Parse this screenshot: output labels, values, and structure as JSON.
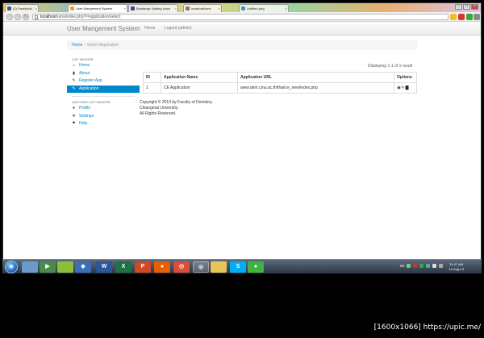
{
  "browser": {
    "tabs": [
      {
        "label": "(2) Facebook",
        "color": "#3b5998"
      },
      {
        "label": "User Mangement System",
        "color": "#e8a33a"
      },
      {
        "label": "Bootstrap: Adding Icons",
        "color": "#563d7c"
      },
      {
        "label": "localhost/ums",
        "color": "#7a7a7a"
      },
      {
        "label": "Untitled-png",
        "color": "#4a90d9"
      }
    ],
    "url_host": "localhost",
    "url_path": "/ums/index.php?r=application/select"
  },
  "site": {
    "brand": "User Mangement System",
    "nav": {
      "home": "Home",
      "logout": "Logout (admin)"
    }
  },
  "breadcrumb": {
    "home": "Home",
    "separator": "/",
    "current": "Select Application"
  },
  "sidebar": {
    "header1": "LIST HEADER",
    "items1": [
      {
        "label": "Home",
        "icon": "home-icon"
      },
      {
        "label": "About",
        "icon": "book-icon"
      },
      {
        "label": "Register App",
        "icon": "pencil-icon"
      },
      {
        "label": "Application",
        "icon": "pencil-icon"
      }
    ],
    "header2": "ANOTHER LIST HEADER",
    "items2": [
      {
        "label": "Profile",
        "icon": "user-icon"
      },
      {
        "label": "Settings",
        "icon": "gear-icon"
      },
      {
        "label": "Help",
        "icon": "flag-icon"
      }
    ]
  },
  "summary": "Displaying 1-1 of 1 result",
  "table": {
    "headers": [
      "ID",
      "Application Name",
      "Application URL",
      "Options"
    ],
    "rows": [
      {
        "id": "1",
        "name": "CE Application",
        "url": "www.dent.cmu.ac.th/thai/ce_new/index.php"
      }
    ]
  },
  "footer": {
    "line1": "Copyright © 2013 by Faculty of Dentistry.",
    "line2": "Chiangmai University.",
    "line3": "All Rights Reserved."
  },
  "taskbar": {
    "lang": "TH",
    "time": "11:47 AM",
    "date": "14-Aug-13",
    "icons": [
      "explorer-icon",
      "media-icon",
      "files-icon",
      "virtualbox-icon",
      "word-icon",
      "excel-icon",
      "powerpoint-icon",
      "firefox-icon",
      "chrome-icon",
      "folder-icon",
      "skype-icon",
      "line-icon"
    ]
  },
  "watermark": "[1600x1066] https://upic.me/"
}
